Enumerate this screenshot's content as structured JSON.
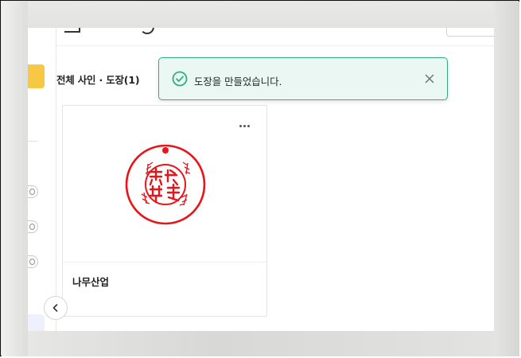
{
  "content": {
    "heading": "전체 사인 · 도장(1)"
  },
  "card": {
    "name": "나무산업",
    "more_icon": "more-horizontal-icon",
    "stamp_color": "#e8141a"
  },
  "toast": {
    "message": "도장을 만들었습니다.",
    "status_icon": "check-circle-icon",
    "close_icon": "close-icon",
    "accent_color": "#2fae84",
    "background_color": "#eaf7f2"
  },
  "sidebar": {
    "highlight_color": "#f7c843",
    "collapse_icon": "chevron-left-icon"
  }
}
